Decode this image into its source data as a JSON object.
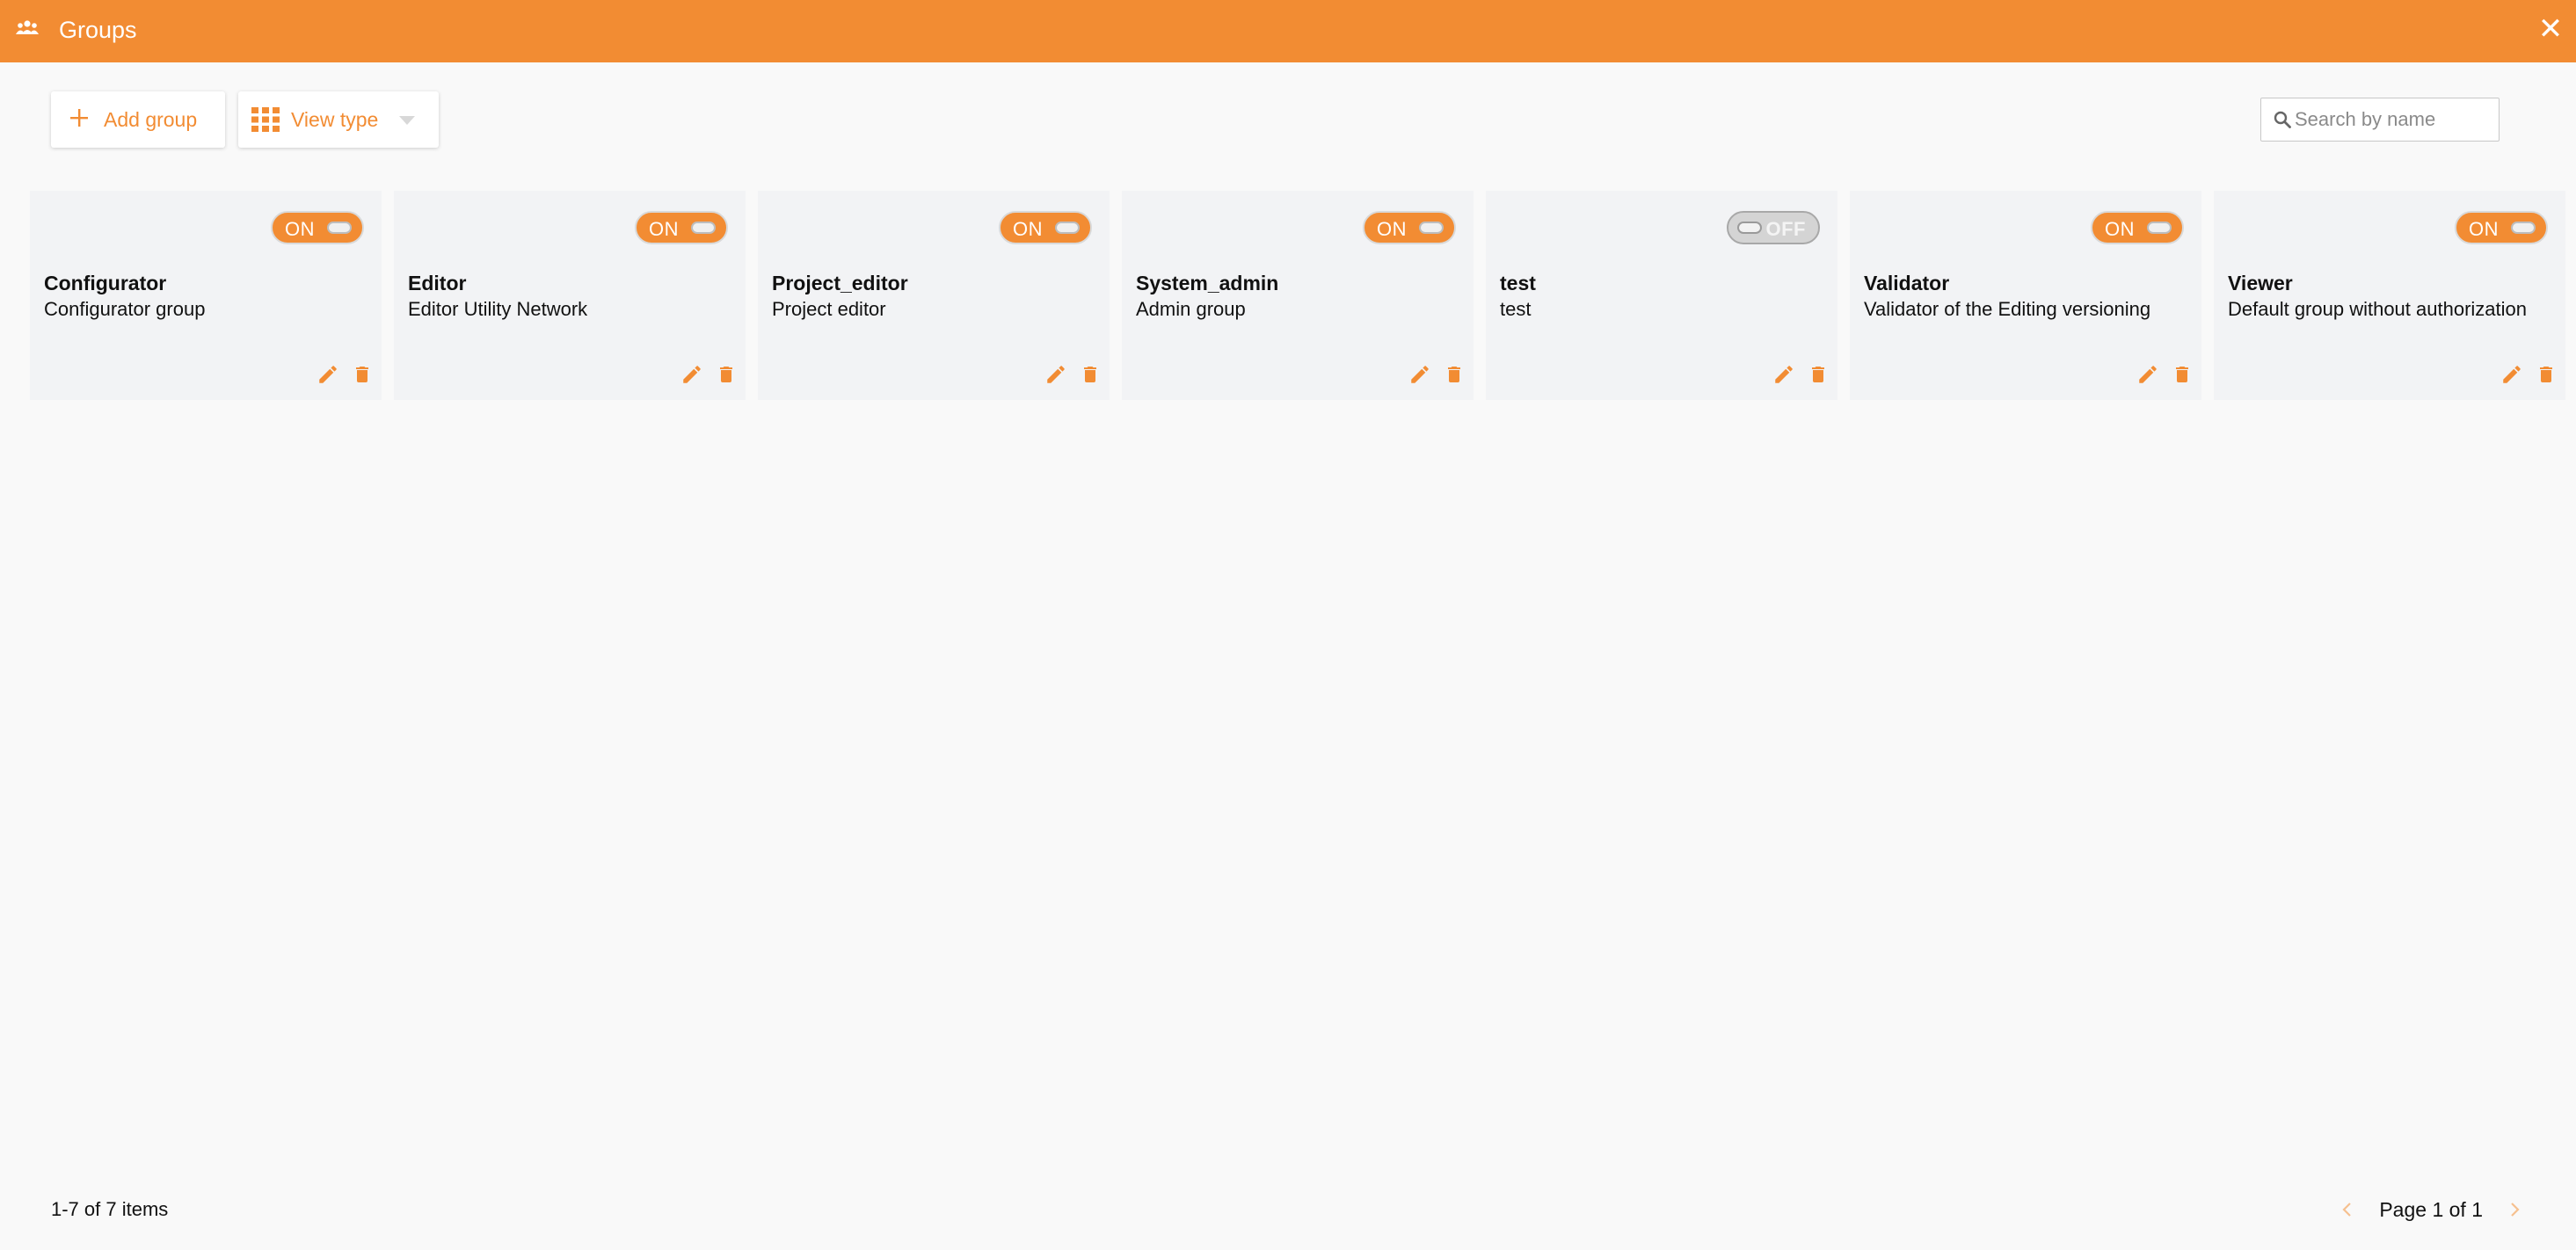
{
  "window": {
    "title": "Groups",
    "title_icon": "users-icon",
    "close_icon": "close-icon",
    "accent_color": "#f28c33"
  },
  "toolbar": {
    "add_group_label": "Add group",
    "view_type_label": "View type"
  },
  "search": {
    "placeholder": "Search by name",
    "value": ""
  },
  "groups": [
    {
      "name": "Configurator",
      "description": "Configurator group",
      "status": "ON"
    },
    {
      "name": "Editor",
      "description": "Editor Utility Network",
      "status": "ON"
    },
    {
      "name": "Project_editor",
      "description": "Project editor",
      "status": "ON"
    },
    {
      "name": "System_admin",
      "description": "Admin group",
      "status": "ON"
    },
    {
      "name": "test",
      "description": "test",
      "status": "OFF"
    },
    {
      "name": "Validator",
      "description": "Validator of the Editing versioning",
      "status": "ON"
    },
    {
      "name": "Viewer",
      "description": "Default group without authorization",
      "status": "ON"
    }
  ],
  "footer": {
    "items_count": "1-7 of 7 items",
    "page_text": "Page 1 of 1"
  }
}
